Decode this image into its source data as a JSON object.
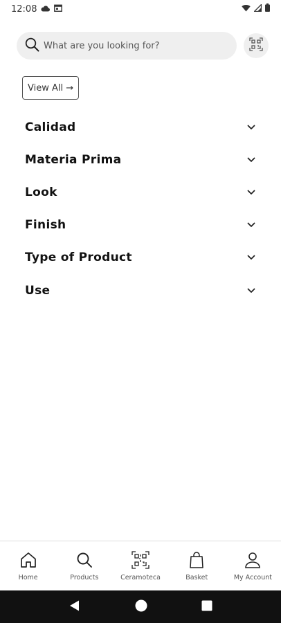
{
  "status_bar": {
    "time": "12:08"
  },
  "search": {
    "placeholder": "What are you looking for?"
  },
  "view_all": {
    "label": "View All →"
  },
  "filters": [
    {
      "label": "Calidad"
    },
    {
      "label": "Materia Prima"
    },
    {
      "label": "Look"
    },
    {
      "label": "Finish"
    },
    {
      "label": "Type of Product"
    },
    {
      "label": "Use"
    }
  ],
  "bottom_nav": {
    "items": [
      {
        "label": "Home",
        "icon": "home-icon"
      },
      {
        "label": "Products",
        "icon": "search-icon"
      },
      {
        "label": "Ceramoteca",
        "icon": "qr-code-icon"
      },
      {
        "label": "Basket",
        "icon": "shopping-bag-icon"
      },
      {
        "label": "My Account",
        "icon": "user-icon"
      }
    ]
  }
}
